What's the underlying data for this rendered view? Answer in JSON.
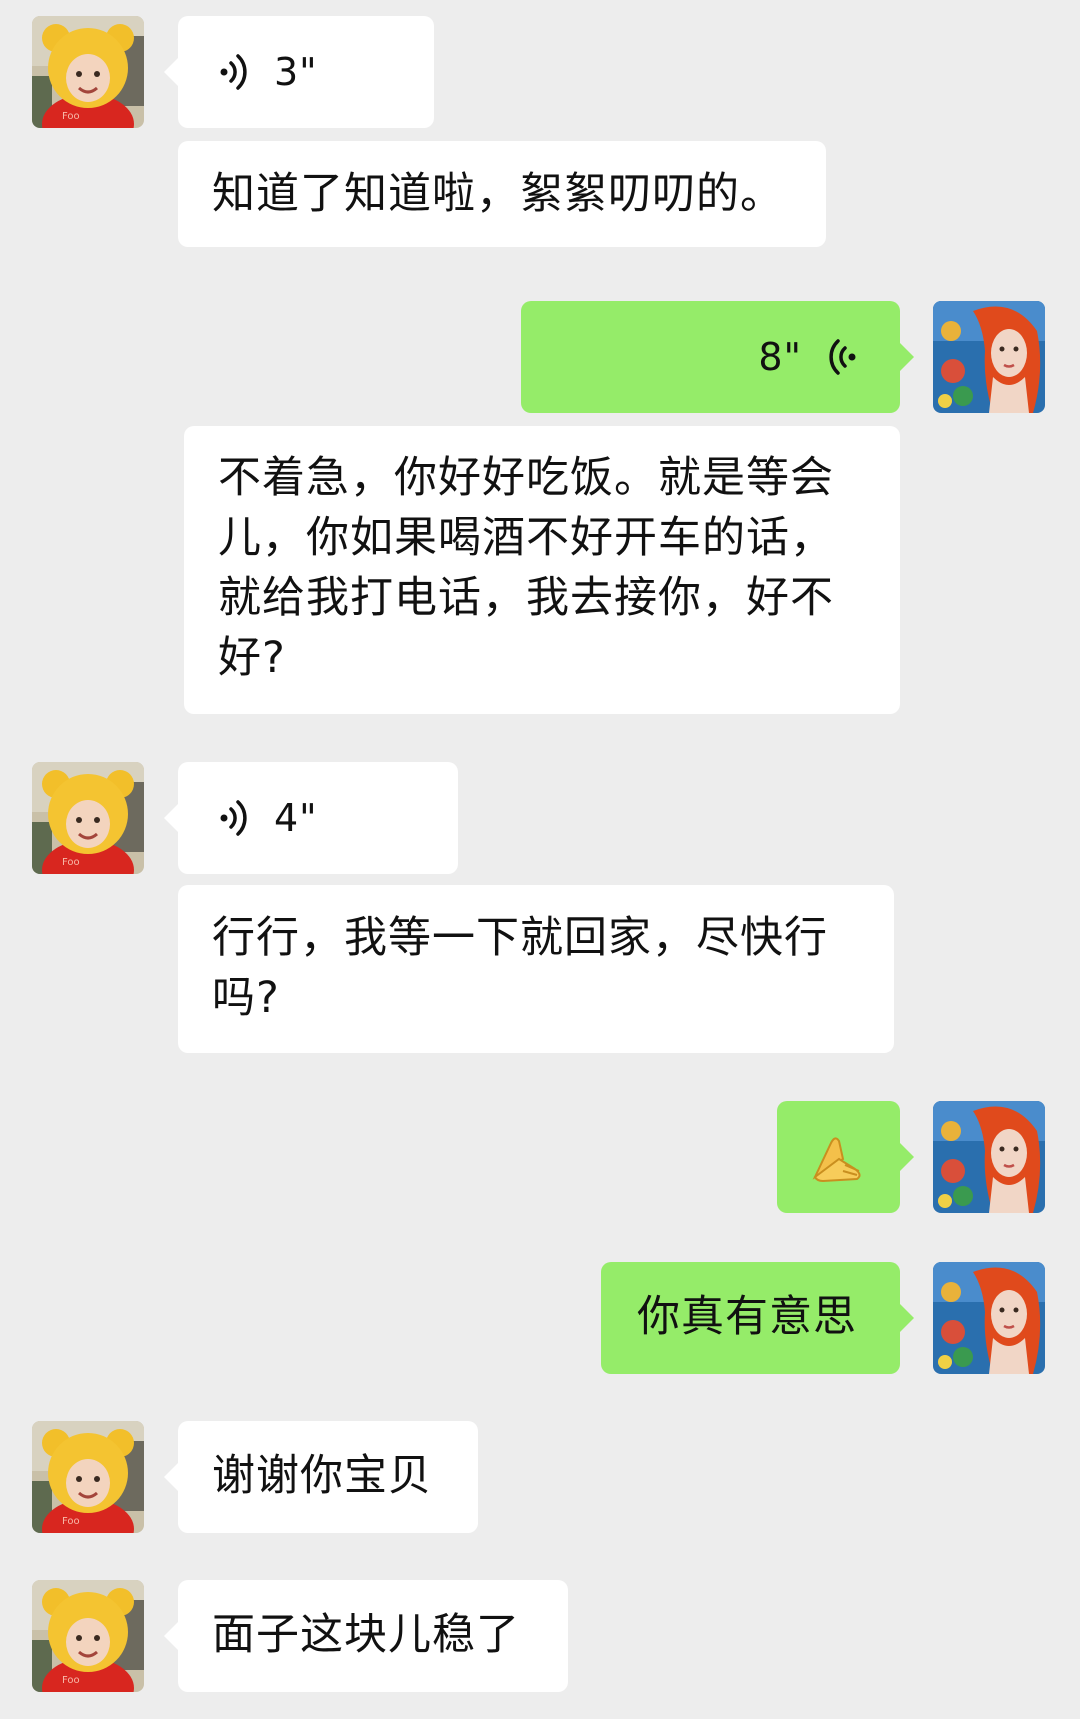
{
  "messages": [
    {
      "side": "in",
      "type": "voice",
      "duration": "3\""
    },
    {
      "side": "in",
      "type": "text",
      "text": "知道了知道啦，絮絮叨叨的。"
    },
    {
      "side": "out",
      "type": "voice",
      "duration": "8\""
    },
    {
      "side": "out",
      "type": "text",
      "text": "不着急，你好好吃饭。就是等会儿，你如果喝酒不好开车的话，就给我打电话，我去接你，好不好?"
    },
    {
      "side": "in",
      "type": "voice",
      "duration": "4\""
    },
    {
      "side": "in",
      "type": "text",
      "text": "行行，我等一下就回家，尽快行吗?"
    },
    {
      "side": "out",
      "type": "emoji",
      "icon": "folded-hands-icon"
    },
    {
      "side": "out",
      "type": "text",
      "text": "你真有意思"
    },
    {
      "side": "in",
      "type": "text",
      "text": "谢谢你宝贝"
    },
    {
      "side": "in",
      "type": "text",
      "text": "面子这块儿稳了"
    }
  ],
  "colors": {
    "background": "#ededed",
    "incoming_bubble": "#ffffff",
    "outgoing_bubble": "#95ec69",
    "text": "#111111"
  },
  "avatars": {
    "incoming": "child-in-yellow-bear-hat-avatar",
    "outgoing": "red-haired-girl-ocean-avatar"
  }
}
